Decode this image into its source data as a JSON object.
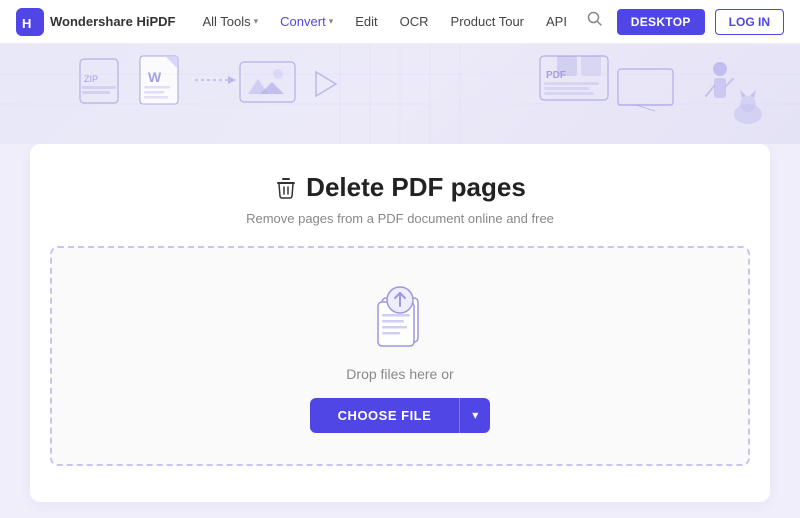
{
  "brand": {
    "name": "Wondershare HiPDF",
    "logo_unicode": "H"
  },
  "navbar": {
    "items": [
      {
        "label": "All Tools",
        "has_arrow": true
      },
      {
        "label": "Convert",
        "has_arrow": true,
        "active": true
      },
      {
        "label": "Edit",
        "has_arrow": false
      },
      {
        "label": "OCR",
        "has_arrow": false
      },
      {
        "label": "Product Tour",
        "has_arrow": false
      },
      {
        "label": "API",
        "has_arrow": false
      }
    ],
    "desktop_btn": "DESKTOP",
    "login_btn": "LOG IN"
  },
  "page": {
    "title": "Delete PDF pages",
    "subtitle": "Remove pages from a PDF document online and free",
    "drop_text": "Drop files here or",
    "choose_file_btn": "CHOOSE FILE",
    "dropdown_arrow": "▾"
  },
  "colors": {
    "primary": "#4f46e5",
    "primary_dark": "#4338ca",
    "border_dashed": "#c8c5ee"
  }
}
